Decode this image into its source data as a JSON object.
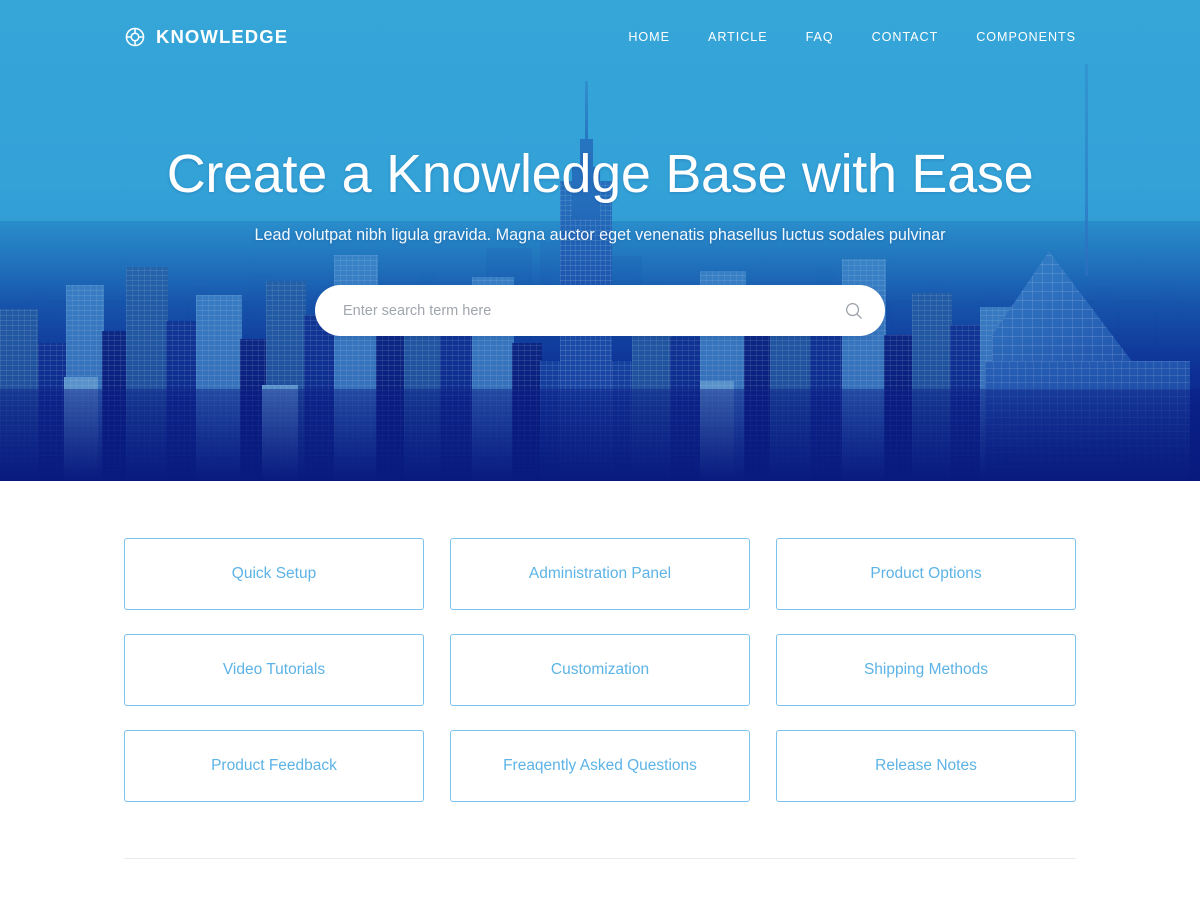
{
  "brand": {
    "name": "KNOWLEDGE",
    "icon": "lifebuoy-icon"
  },
  "nav": {
    "items": [
      {
        "label": "HOME"
      },
      {
        "label": "ARTICLE"
      },
      {
        "label": "FAQ"
      },
      {
        "label": "CONTACT"
      },
      {
        "label": "COMPONENTS"
      }
    ]
  },
  "hero": {
    "title": "Create a Knowledge Base with Ease",
    "subtitle": "Lead volutpat nibh ligula gravida. Magna auctor eget venenatis phasellus luctus sodales pulvinar",
    "background_image": "new-york-city-skyline-photo",
    "overlay_color": "#35a4d8",
    "deep_color": "#0a1f86"
  },
  "search": {
    "placeholder": "Enter search term here",
    "value": "",
    "icon": "search-icon"
  },
  "categories": [
    {
      "label": "Quick Setup"
    },
    {
      "label": "Administration Panel"
    },
    {
      "label": "Product Options"
    },
    {
      "label": "Video Tutorials"
    },
    {
      "label": "Customization"
    },
    {
      "label": "Shipping Methods"
    },
    {
      "label": "Product Feedback"
    },
    {
      "label": "Freaqently Asked Questions"
    },
    {
      "label": "Release Notes"
    }
  ],
  "theme": {
    "accent": "#35a4d8",
    "card_border": "#7cc3ee",
    "card_text": "#5cb3e6",
    "divider": "#e9eaec"
  }
}
